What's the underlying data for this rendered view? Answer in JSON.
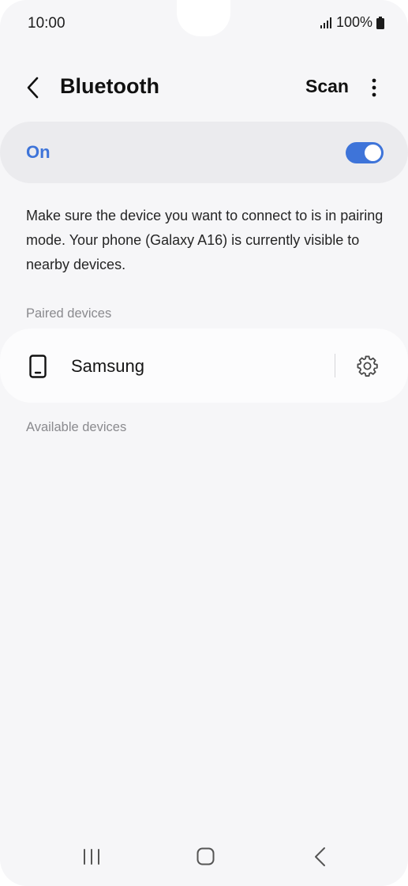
{
  "status_bar": {
    "time": "10:00",
    "battery": "100%"
  },
  "app_bar": {
    "title": "Bluetooth",
    "scan_label": "Scan"
  },
  "toggle": {
    "label": "On",
    "state": true,
    "accent_color": "#3e74d9"
  },
  "description": "Make sure the device you want to connect to is in pairing mode. Your phone (Galaxy A16) is currently visible to nearby devices.",
  "paired": {
    "header": "Paired devices",
    "devices": [
      {
        "name": "Samsung",
        "icon": "phone-icon"
      }
    ]
  },
  "available": {
    "header": "Available devices"
  },
  "nav": {
    "icons": [
      "recents-icon",
      "home-icon",
      "back-icon"
    ]
  }
}
